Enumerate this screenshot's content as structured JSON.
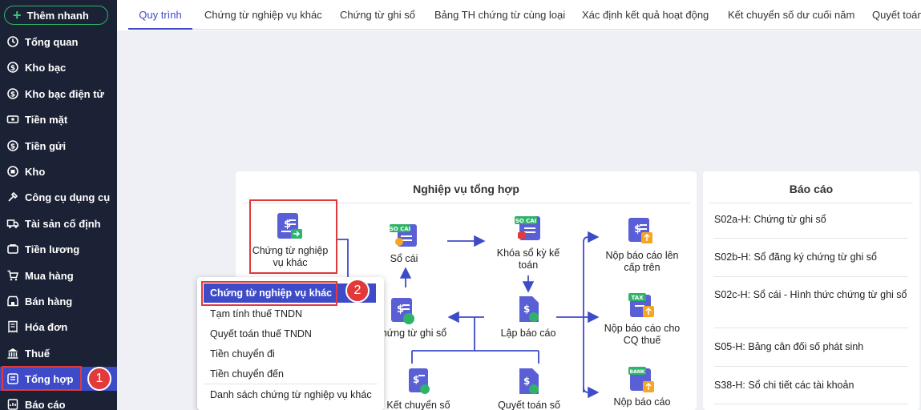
{
  "sidebar": {
    "quick_add": "Thêm nhanh",
    "items": [
      {
        "label": "Tổng quan",
        "icon": "clock-icon"
      },
      {
        "label": "Kho bạc",
        "icon": "dollar-circle-icon"
      },
      {
        "label": "Kho bạc điện tử",
        "icon": "dollar-circle-icon"
      },
      {
        "label": "Tiền mặt",
        "icon": "cash-icon"
      },
      {
        "label": "Tiền gửi",
        "icon": "deposit-icon"
      },
      {
        "label": "Kho",
        "icon": "warehouse-icon"
      },
      {
        "label": "Công cụ dụng cụ",
        "icon": "tools-icon"
      },
      {
        "label": "Tài sản cố định",
        "icon": "truck-icon"
      },
      {
        "label": "Tiền lương",
        "icon": "wallet-icon"
      },
      {
        "label": "Mua hàng",
        "icon": "cart-icon"
      },
      {
        "label": "Bán hàng",
        "icon": "store-icon"
      },
      {
        "label": "Hóa đơn",
        "icon": "invoice-icon"
      },
      {
        "label": "Thuế",
        "icon": "bank-icon"
      },
      {
        "label": "Tổng hợp",
        "icon": "summary-icon"
      },
      {
        "label": "Báo cáo",
        "icon": "report-icon"
      }
    ],
    "active_index": 13,
    "badge": "1"
  },
  "tabs": [
    {
      "label": "Quy trình"
    },
    {
      "label": "Chứng từ nghiệp vụ khác"
    },
    {
      "label": "Chứng từ ghi sổ"
    },
    {
      "label": "Bảng TH chứng từ cùng loại"
    },
    {
      "label": "Xác định kết quả hoạt động"
    },
    {
      "label": "Kết chuyển số dư cuối năm"
    },
    {
      "label": "Quyết toán"
    }
  ],
  "flow": {
    "title": "Nghiệp vụ tổng hợp",
    "nodes": {
      "ctnvk": "Chứng từ nghiệp vụ khác",
      "so_cai": "Sổ cái",
      "khoa_so": "Khóa sổ kỳ kế toán",
      "nop_bc_tren": "Nộp báo cáo lên cấp trên",
      "ct_ghi_so": "Chứng từ ghi sổ",
      "lap_bc": "Lập báo cáo",
      "nop_bc_thue": "Nộp báo cáo cho CQ thuế",
      "ket_chuyen": "Kết chuyển số",
      "quyet_toan": "Quyết toán số",
      "nop_bc_kb": "Nộp báo cáo"
    },
    "icon_tags": {
      "so_cai": "SO CAI",
      "tax": "TAX",
      "bank": "BANK"
    }
  },
  "reports": {
    "title": "Báo cáo",
    "items": [
      "S02a-H: Chứng từ ghi sổ",
      "S02b-H: Sổ đăng ký chứng từ ghi sổ",
      "S02c-H: Sổ cái - Hình thức chứng từ ghi sổ",
      "S05-H: Bảng cân đối số phát sinh",
      "S38-H: Sổ chi tiết các tài khoản"
    ]
  },
  "menu": {
    "items": [
      "Chứng từ nghiệp vụ khác",
      "Tạm tính thuế TNDN",
      "Quyết toán thuế TNDN",
      "Tiền chuyển đi",
      "Tiền chuyển đến",
      "Danh sách chứng từ nghiệp vụ khác"
    ],
    "badge": "2"
  },
  "colors": {
    "sidebar": "#1c2236",
    "accent": "#3e4bc8",
    "highlight": "#e03a3a",
    "icon": "#5b5fd6",
    "icon_accent": "#2fb36a"
  }
}
